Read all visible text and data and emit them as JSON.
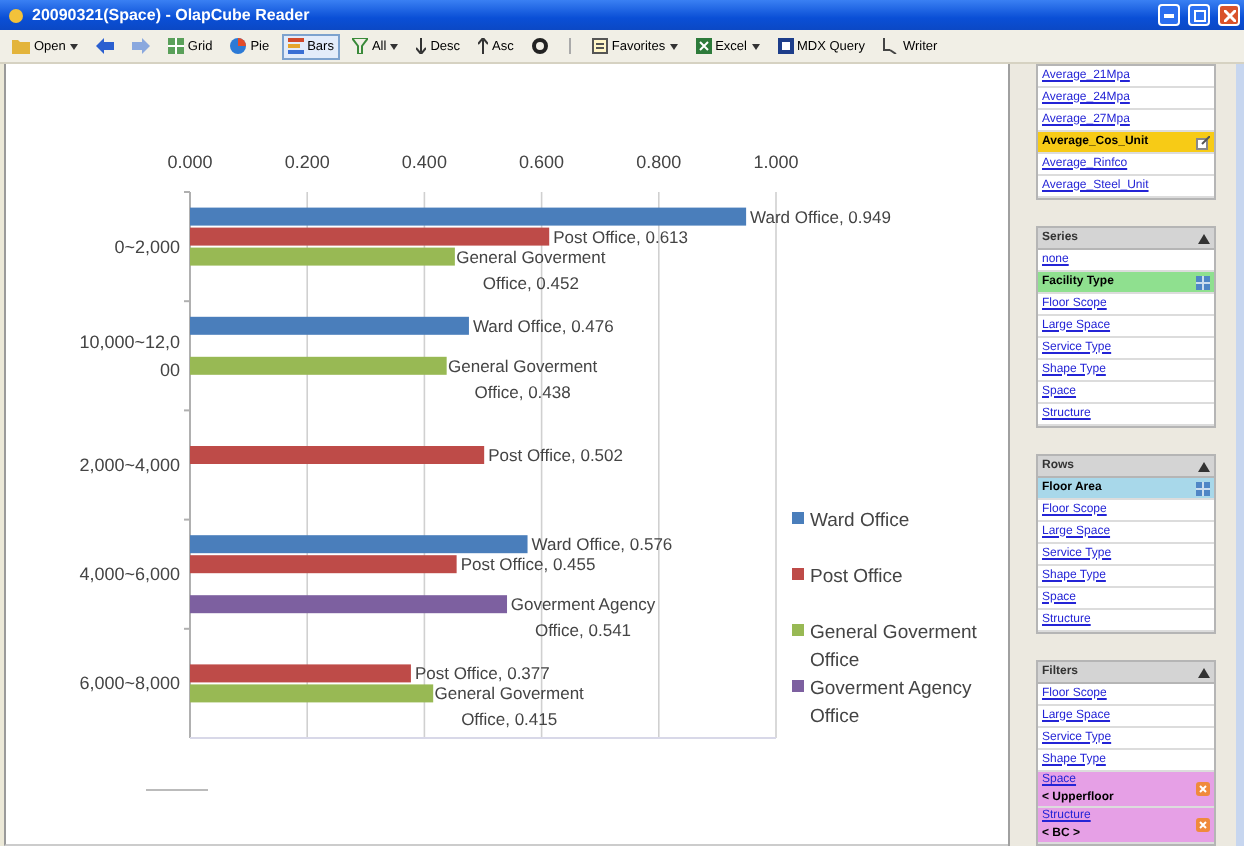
{
  "window": {
    "title": "20090321(Space) - OlapCube Reader"
  },
  "toolbar": [
    {
      "kind": "dropdown",
      "label": "Open",
      "selected": false
    },
    {
      "kind": "icon",
      "selected": false
    },
    {
      "kind": "icon",
      "selected": false
    },
    {
      "kind": "button",
      "label": "Grid",
      "selected": false
    },
    {
      "kind": "button",
      "label": "Pie",
      "selected": false
    },
    {
      "kind": "button",
      "label": "Bars",
      "selected": true
    },
    {
      "kind": "dropdown",
      "label": "All",
      "selected": false
    },
    {
      "kind": "button",
      "label": "Desc",
      "selected": false
    },
    {
      "kind": "button",
      "label": "Asc",
      "selected": false
    },
    {
      "kind": "icon",
      "selected": false
    },
    {
      "kind": "icon",
      "selected": false
    },
    {
      "kind": "dropdown",
      "label": "Favorites",
      "selected": false
    },
    {
      "kind": "dropdown",
      "label": "Excel",
      "selected": false
    },
    {
      "kind": "button",
      "label": "MDX Query",
      "selected": false
    },
    {
      "kind": "button",
      "label": "Writer",
      "selected": false
    }
  ],
  "chart_data": {
    "type": "bar",
    "orientation": "horizontal",
    "grid": true,
    "legend": true,
    "xlim": [
      0,
      1
    ],
    "xticks": [
      {
        "value": 0,
        "label": "0.000"
      },
      {
        "value": 0.2,
        "label": "0.200"
      },
      {
        "value": 0.4,
        "label": "0.400"
      },
      {
        "value": 0.6,
        "label": "0.600"
      },
      {
        "value": 0.8,
        "label": "0.800"
      },
      {
        "value": 1,
        "label": "1.000"
      }
    ],
    "categories": [
      "0~2,000",
      "10,000~12,000",
      "2,000~4,000",
      "4,000~6,000",
      "6,000~8,000"
    ],
    "series": [
      {
        "name": "Ward Office",
        "color": "#4a7ebb",
        "values": [
          0.949,
          0.476,
          null,
          0.576,
          null
        ],
        "value_labels": [
          "Ward Office, 0.949",
          "Ward Office, 0.476",
          null,
          "Ward Office, 0.576",
          null
        ]
      },
      {
        "name": "Post Office",
        "color": "#be4b48",
        "values": [
          0.613,
          null,
          0.502,
          0.455,
          0.377
        ],
        "value_labels": [
          "Post Office, 0.613",
          null,
          "Post Office, 0.502",
          "Post Office, 0.455",
          "Post Office, 0.377"
        ]
      },
      {
        "name": "General Goverment Office",
        "color": "#98b954",
        "values": [
          0.452,
          0.438,
          null,
          null,
          0.415
        ],
        "value_labels": [
          "General Goverment Office, 0.452",
          "General Goverment Office, 0.438",
          null,
          null,
          "General Goverment Office, 0.415"
        ]
      },
      {
        "name": "Goverment Agency Office",
        "color": "#7d60a0",
        "values": [
          null,
          null,
          null,
          0.541,
          null
        ],
        "value_labels": [
          null,
          null,
          null,
          "Goverment Agency Office, 0.541",
          null
        ]
      }
    ]
  },
  "panels": [
    {
      "kind": "measures",
      "items": [
        {
          "label": "Average_21Mpa",
          "selected": false
        },
        {
          "label": "Average_24Mpa",
          "selected": false
        },
        {
          "label": "Average_27Mpa",
          "selected": false
        },
        {
          "label": "Average_Cos_Unit",
          "selected": true
        },
        {
          "label": "Average_Rinfco",
          "selected": false
        },
        {
          "label": "Average_Steel_Unit",
          "selected": false
        }
      ]
    },
    {
      "kind": "series",
      "title": "Series",
      "items": [
        {
          "label": "none",
          "selected": false
        },
        {
          "label": "Facility Type",
          "selected": true
        },
        {
          "label": "Floor Scope",
          "selected": false
        },
        {
          "label": "Large Space",
          "selected": false
        },
        {
          "label": "Service Type",
          "selected": false
        },
        {
          "label": "Shape Type",
          "selected": false
        },
        {
          "label": "Space",
          "selected": false
        },
        {
          "label": "Structure",
          "selected": false
        }
      ]
    },
    {
      "kind": "rows",
      "title": "Rows",
      "items": [
        {
          "label": "Floor Area",
          "selected": true
        },
        {
          "label": "Floor Scope",
          "selected": false
        },
        {
          "label": "Large Space",
          "selected": false
        },
        {
          "label": "Service Type",
          "selected": false
        },
        {
          "label": "Shape Type",
          "selected": false
        },
        {
          "label": "Space",
          "selected": false
        },
        {
          "label": "Structure",
          "selected": false
        }
      ]
    },
    {
      "kind": "filters",
      "title": "Filters",
      "items": [
        {
          "label": "Floor Scope",
          "selected": false
        },
        {
          "label": "Large Space",
          "selected": false
        },
        {
          "label": "Service Type",
          "selected": false
        },
        {
          "label": "Shape Type",
          "selected": false
        },
        {
          "label": "Space",
          "value": "< Upperfloor",
          "selected": false
        },
        {
          "label": "Structure",
          "value": "< BC >",
          "selected": false
        }
      ]
    }
  ]
}
